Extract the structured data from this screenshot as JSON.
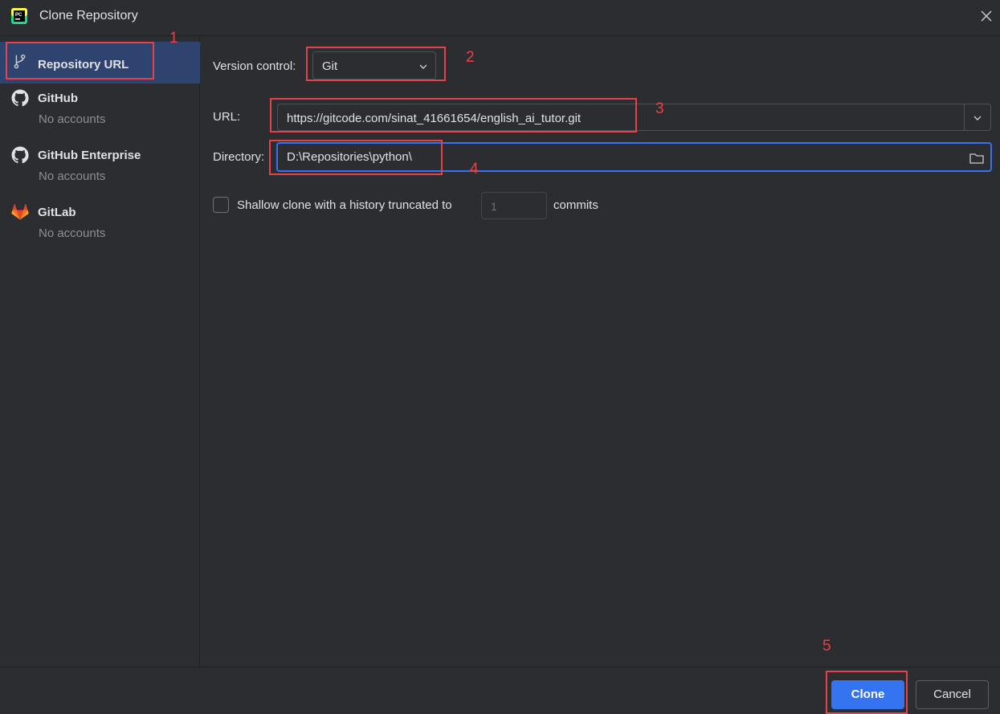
{
  "window": {
    "title": "Clone Repository",
    "app_icon": "pycharm-icon",
    "close_icon": "close-icon"
  },
  "sidebar": {
    "items": [
      {
        "label": "Repository URL",
        "sub": "",
        "icon": "git-branch-icon",
        "selected": true
      },
      {
        "label": "GitHub",
        "sub": "No accounts",
        "icon": "github-icon",
        "selected": false
      },
      {
        "label": "GitHub Enterprise",
        "sub": "No accounts",
        "icon": "github-icon",
        "selected": false
      },
      {
        "label": "GitLab",
        "sub": "No accounts",
        "icon": "gitlab-icon",
        "selected": false
      }
    ]
  },
  "form": {
    "vcs_label": "Version control:",
    "vcs_value": "Git",
    "url_label": "URL:",
    "url_value": "https://gitcode.com/sinat_41661654/english_ai_tutor.git",
    "dir_label": "Directory:",
    "dir_value": "D:\\Repositories\\python\\",
    "shallow_label": "Shallow clone with a history truncated to",
    "shallow_depth": "1",
    "shallow_suffix": "commits",
    "shallow_checked": false
  },
  "footer": {
    "clone_label": "Clone",
    "cancel_label": "Cancel"
  },
  "annotations": [
    "1",
    "2",
    "3",
    "4",
    "5"
  ],
  "colors": {
    "background": "#2b2d30",
    "accent": "#3574f0",
    "selection": "#2e436e",
    "annotation": "#e5424b",
    "muted_text": "#8c8f94"
  }
}
